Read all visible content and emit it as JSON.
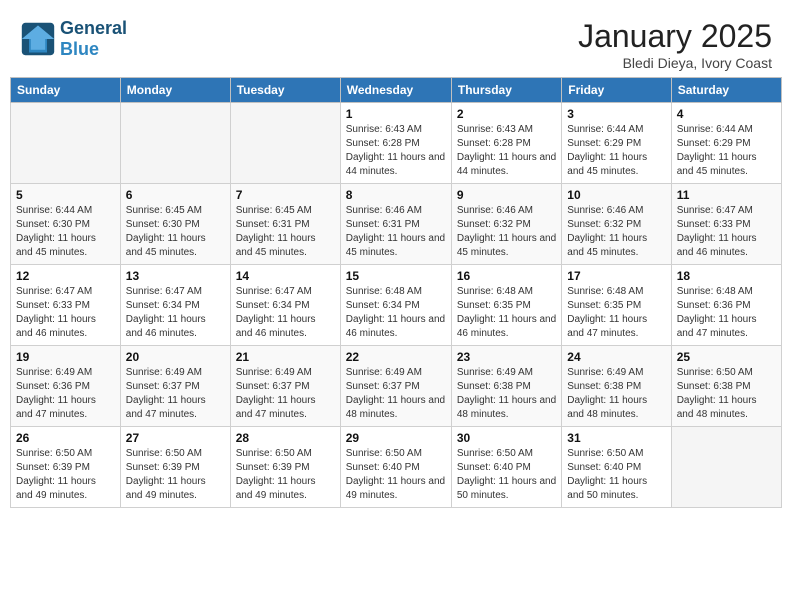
{
  "header": {
    "logo_general": "General",
    "logo_blue": "Blue",
    "month_year": "January 2025",
    "location": "Bledi Dieya, Ivory Coast"
  },
  "weekdays": [
    "Sunday",
    "Monday",
    "Tuesday",
    "Wednesday",
    "Thursday",
    "Friday",
    "Saturday"
  ],
  "weeks": [
    [
      {
        "day": "",
        "info": ""
      },
      {
        "day": "",
        "info": ""
      },
      {
        "day": "",
        "info": ""
      },
      {
        "day": "1",
        "info": "Sunrise: 6:43 AM\nSunset: 6:28 PM\nDaylight: 11 hours and 44 minutes."
      },
      {
        "day": "2",
        "info": "Sunrise: 6:43 AM\nSunset: 6:28 PM\nDaylight: 11 hours and 44 minutes."
      },
      {
        "day": "3",
        "info": "Sunrise: 6:44 AM\nSunset: 6:29 PM\nDaylight: 11 hours and 45 minutes."
      },
      {
        "day": "4",
        "info": "Sunrise: 6:44 AM\nSunset: 6:29 PM\nDaylight: 11 hours and 45 minutes."
      }
    ],
    [
      {
        "day": "5",
        "info": "Sunrise: 6:44 AM\nSunset: 6:30 PM\nDaylight: 11 hours and 45 minutes."
      },
      {
        "day": "6",
        "info": "Sunrise: 6:45 AM\nSunset: 6:30 PM\nDaylight: 11 hours and 45 minutes."
      },
      {
        "day": "7",
        "info": "Sunrise: 6:45 AM\nSunset: 6:31 PM\nDaylight: 11 hours and 45 minutes."
      },
      {
        "day": "8",
        "info": "Sunrise: 6:46 AM\nSunset: 6:31 PM\nDaylight: 11 hours and 45 minutes."
      },
      {
        "day": "9",
        "info": "Sunrise: 6:46 AM\nSunset: 6:32 PM\nDaylight: 11 hours and 45 minutes."
      },
      {
        "day": "10",
        "info": "Sunrise: 6:46 AM\nSunset: 6:32 PM\nDaylight: 11 hours and 45 minutes."
      },
      {
        "day": "11",
        "info": "Sunrise: 6:47 AM\nSunset: 6:33 PM\nDaylight: 11 hours and 46 minutes."
      }
    ],
    [
      {
        "day": "12",
        "info": "Sunrise: 6:47 AM\nSunset: 6:33 PM\nDaylight: 11 hours and 46 minutes."
      },
      {
        "day": "13",
        "info": "Sunrise: 6:47 AM\nSunset: 6:34 PM\nDaylight: 11 hours and 46 minutes."
      },
      {
        "day": "14",
        "info": "Sunrise: 6:47 AM\nSunset: 6:34 PM\nDaylight: 11 hours and 46 minutes."
      },
      {
        "day": "15",
        "info": "Sunrise: 6:48 AM\nSunset: 6:34 PM\nDaylight: 11 hours and 46 minutes."
      },
      {
        "day": "16",
        "info": "Sunrise: 6:48 AM\nSunset: 6:35 PM\nDaylight: 11 hours and 46 minutes."
      },
      {
        "day": "17",
        "info": "Sunrise: 6:48 AM\nSunset: 6:35 PM\nDaylight: 11 hours and 47 minutes."
      },
      {
        "day": "18",
        "info": "Sunrise: 6:48 AM\nSunset: 6:36 PM\nDaylight: 11 hours and 47 minutes."
      }
    ],
    [
      {
        "day": "19",
        "info": "Sunrise: 6:49 AM\nSunset: 6:36 PM\nDaylight: 11 hours and 47 minutes."
      },
      {
        "day": "20",
        "info": "Sunrise: 6:49 AM\nSunset: 6:37 PM\nDaylight: 11 hours and 47 minutes."
      },
      {
        "day": "21",
        "info": "Sunrise: 6:49 AM\nSunset: 6:37 PM\nDaylight: 11 hours and 47 minutes."
      },
      {
        "day": "22",
        "info": "Sunrise: 6:49 AM\nSunset: 6:37 PM\nDaylight: 11 hours and 48 minutes."
      },
      {
        "day": "23",
        "info": "Sunrise: 6:49 AM\nSunset: 6:38 PM\nDaylight: 11 hours and 48 minutes."
      },
      {
        "day": "24",
        "info": "Sunrise: 6:49 AM\nSunset: 6:38 PM\nDaylight: 11 hours and 48 minutes."
      },
      {
        "day": "25",
        "info": "Sunrise: 6:50 AM\nSunset: 6:38 PM\nDaylight: 11 hours and 48 minutes."
      }
    ],
    [
      {
        "day": "26",
        "info": "Sunrise: 6:50 AM\nSunset: 6:39 PM\nDaylight: 11 hours and 49 minutes."
      },
      {
        "day": "27",
        "info": "Sunrise: 6:50 AM\nSunset: 6:39 PM\nDaylight: 11 hours and 49 minutes."
      },
      {
        "day": "28",
        "info": "Sunrise: 6:50 AM\nSunset: 6:39 PM\nDaylight: 11 hours and 49 minutes."
      },
      {
        "day": "29",
        "info": "Sunrise: 6:50 AM\nSunset: 6:40 PM\nDaylight: 11 hours and 49 minutes."
      },
      {
        "day": "30",
        "info": "Sunrise: 6:50 AM\nSunset: 6:40 PM\nDaylight: 11 hours and 50 minutes."
      },
      {
        "day": "31",
        "info": "Sunrise: 6:50 AM\nSunset: 6:40 PM\nDaylight: 11 hours and 50 minutes."
      },
      {
        "day": "",
        "info": ""
      }
    ]
  ]
}
